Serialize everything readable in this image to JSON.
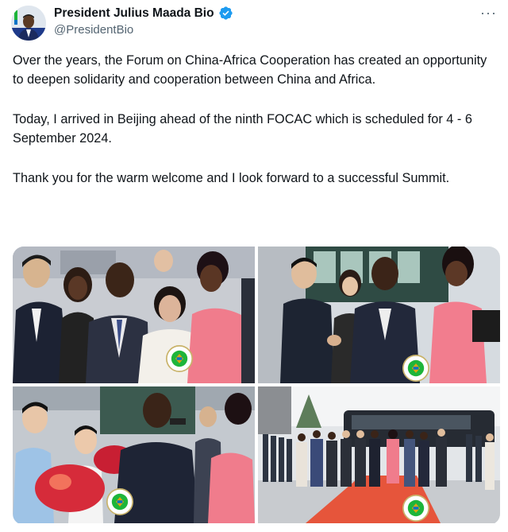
{
  "author": {
    "name": "President Julius Maada Bio",
    "handle": "@PresidentBio",
    "verified": true,
    "avatar_icon": "profile-avatar-icon"
  },
  "menu": {
    "icon": "more-options-icon",
    "label": "···"
  },
  "tweet": {
    "paragraphs": [
      "Over the years, the Forum on China-Africa Cooperation has created an opportunity to deepen solidarity and cooperation between China and Africa.",
      "Today, I arrived in Beijing ahead of the ninth FOCAC which is scheduled for 4 - 6 September 2024.",
      "Thank you for the warm welcome and I look forward to a successful Summit."
    ]
  },
  "media": {
    "count": 4,
    "photos": [
      {
        "id": "photo-1",
        "seal_icon": "sierra-leone-seal-icon"
      },
      {
        "id": "photo-2",
        "seal_icon": "sierra-leone-seal-icon"
      },
      {
        "id": "photo-3",
        "seal_icon": "sierra-leone-seal-icon"
      },
      {
        "id": "photo-4",
        "seal_icon": "sierra-leone-seal-icon"
      }
    ]
  },
  "colors": {
    "verified_badge": "#1d9bf0",
    "text_primary": "#0f1419",
    "text_secondary": "#536471",
    "pink_suit": "#f07c8c",
    "red_carpet": "#e6553b"
  }
}
